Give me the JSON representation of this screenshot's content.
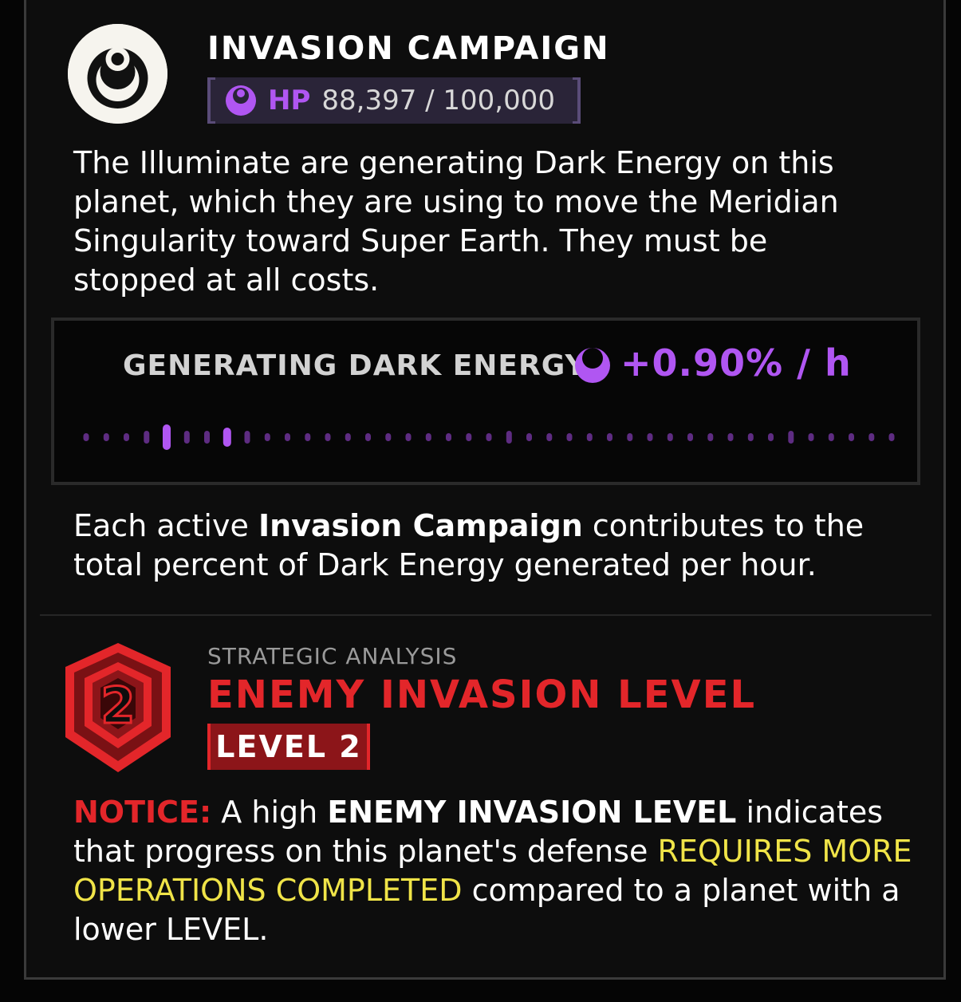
{
  "campaign": {
    "title": "INVASION CAMPAIGN",
    "hp_label": "HP",
    "hp_value": "88,397 / 100,000",
    "description": "The Illuminate are generating Dark Energy on this planet, which they are using to move the Meridian Singularity toward Super Earth. They must be stopped at all costs."
  },
  "dark_energy": {
    "label": "GENERATING DARK ENERGY",
    "rate": "+0.90% / h",
    "accent_color": "#b056f2",
    "indicator_count": 41,
    "highlighted_indices": [
      4,
      7
    ]
  },
  "contribution": {
    "prefix": "Each active ",
    "emphasis": "Invasion Campaign",
    "suffix": " contributes to the total percent of Dark Energy generated per hour."
  },
  "strategic": {
    "section_label": "STRATEGIC ANALYSIS",
    "title": "ENEMY INVASION LEVEL",
    "level_badge": "LEVEL 2",
    "shield_number": "2",
    "accent_color": "#e3262a"
  },
  "notice": {
    "label": "NOTICE:",
    "part1": " A high ",
    "emphasis": "ENEMY INVASION LEVEL",
    "part2": " indicates that progress on this planet's defense ",
    "highlight": "REQUIRES MORE OPERATIONS COMPLETED",
    "part3": " compared to a planet with a lower LEVEL."
  },
  "icons": {
    "faction": "illuminate-emblem-icon",
    "hp": "dark-energy-icon",
    "rate": "dark-energy-icon",
    "level": "invasion-level-shield-icon"
  }
}
